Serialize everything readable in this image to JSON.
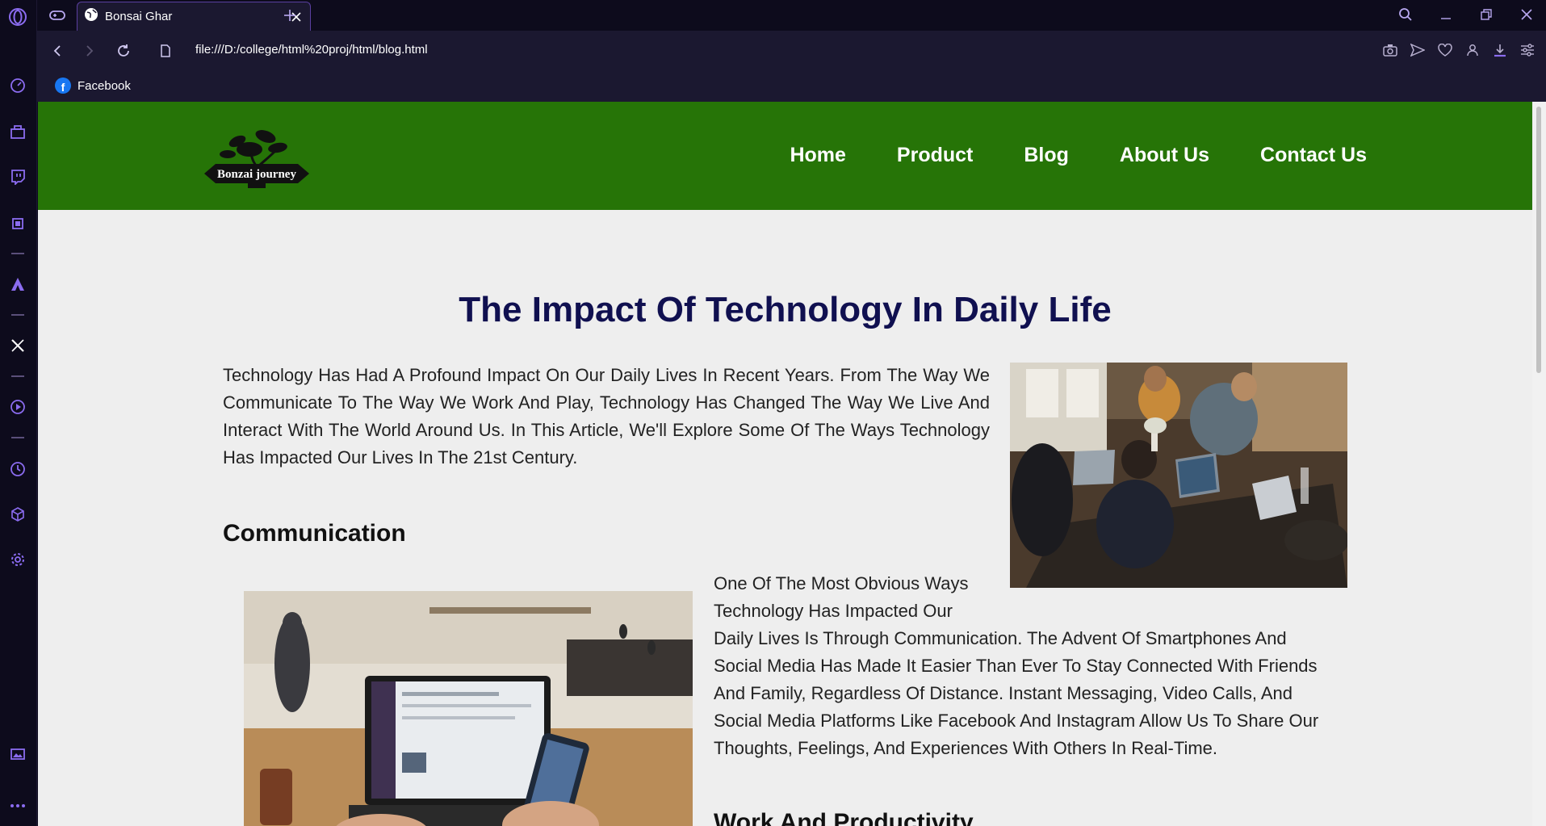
{
  "browser": {
    "tab": {
      "title": "Bonsai Ghar"
    },
    "address": {
      "url": "file:///D:/college/html%20proj/html/blog.html"
    },
    "bookmarks": [
      {
        "label": "Facebook"
      }
    ]
  },
  "site": {
    "logo_text": "Bonzai journey",
    "nav": [
      "Home",
      "Product",
      "Blog",
      "About Us",
      "Contact Us"
    ]
  },
  "article": {
    "title": "The Impact Of Technology In Daily Life",
    "intro": "Technology Has Had A Profound Impact On Our Daily Lives In Recent Years. From The Way We Communicate To The Way We Work And Play, Technology Has Changed The Way We Live And Interact With The World Around Us. In This Article, We'll Explore Some Of The Ways Technology Has Impacted Our Lives In The 21st Century.",
    "sections": [
      {
        "heading": "Communication",
        "lines": [
          "One Of The Most Obvious Ways",
          "Technology Has Impacted Our",
          "Daily Lives Is Through Communication. The Advent Of Smartphones And",
          "Social Media Has Made It Easier Than Ever To Stay Connected With Friends",
          "And Family, Regardless Of Distance. Instant Messaging, Video Calls, And",
          "Social Media Platforms Like Facebook And Instagram Allow Us To Share Our",
          "Thoughts, Feelings, And Experiences With Others In Real-Time."
        ]
      },
      {
        "heading": "Work And Productivity"
      }
    ]
  },
  "colors": {
    "header_green": "#267407",
    "title_navy": "#101050",
    "page_bg": "#eeeeee",
    "browser_dark": "#0d0b1c",
    "accent_purple": "#8b6cf0"
  }
}
